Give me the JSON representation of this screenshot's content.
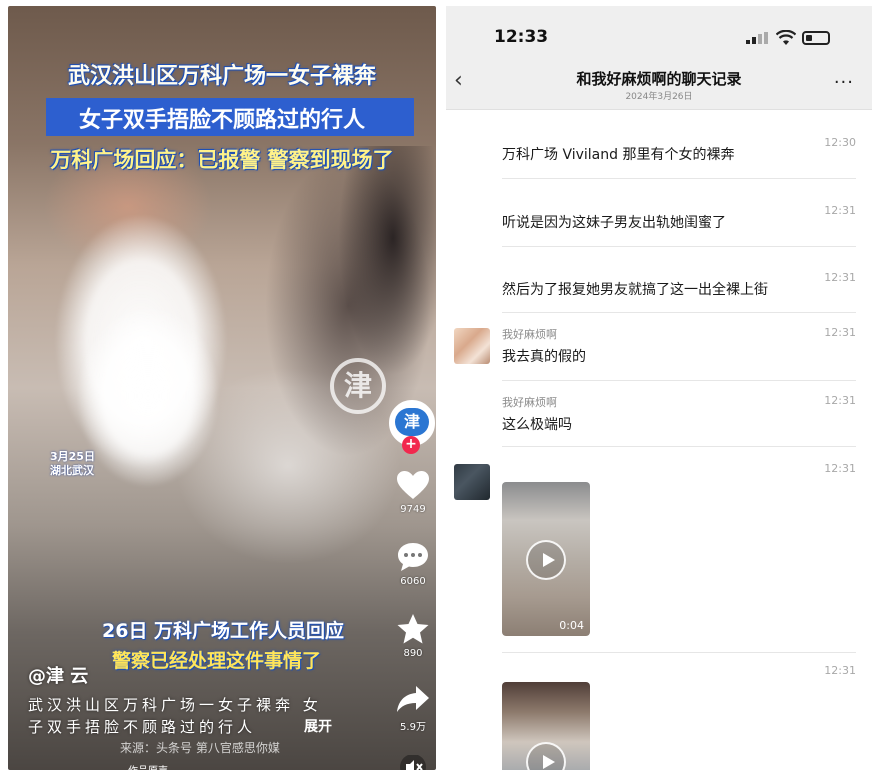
{
  "left_video": {
    "headline1": "武汉洪山区万科广场一女子裸奔",
    "headline2": "女子双手捂脸不顾路过的行人",
    "headline3": "万科广场回应：已报警 警察到现场了",
    "date_tag_line1": "3月25日",
    "date_tag_line2": "湖北武汉",
    "subtitle1": "26日 万科广场工作人员回应",
    "subtitle2": "警察已经处理这件事情了",
    "author": "@津 云",
    "caption_line1": "武汉洪山区万科广场一女子裸奔 女",
    "caption_line2": "子双手捂脸不顾路过的行人",
    "expand": "展开",
    "source": "来源：头条号 第八官感思你媒",
    "music": "作品原声",
    "watermark": "津",
    "avatar_text": "津",
    "follow": "+",
    "likes": "9749",
    "comments": "6060",
    "favorites": "890",
    "shares": "5.9万",
    "colors": {
      "headline_bg": "#2d5fcf",
      "follow": "#f2284e"
    }
  },
  "chat": {
    "status_time": "12:33",
    "title": "和我好麻烦啊的聊天记录",
    "subtitle": "2024年3月26日",
    "messages": [
      {
        "sender": "",
        "time": "12:30",
        "text": "万科广场 Viviland 那里有个女的裸奔"
      },
      {
        "sender": "",
        "time": "12:31",
        "text": "听说是因为这妹子男友出轨她闺蜜了"
      },
      {
        "sender": "",
        "time": "12:31",
        "text": "然后为了报复她男友就搞了这一出全裸上街"
      },
      {
        "sender": "我好麻烦啊",
        "time": "12:31",
        "text": "我去真的假的"
      },
      {
        "sender": "我好麻烦啊",
        "time": "12:31",
        "text": "这么极端吗"
      },
      {
        "sender": "",
        "time": "12:31",
        "text": "",
        "video_duration": "0:04"
      },
      {
        "sender": "",
        "time": "12:31",
        "text": ""
      }
    ]
  }
}
